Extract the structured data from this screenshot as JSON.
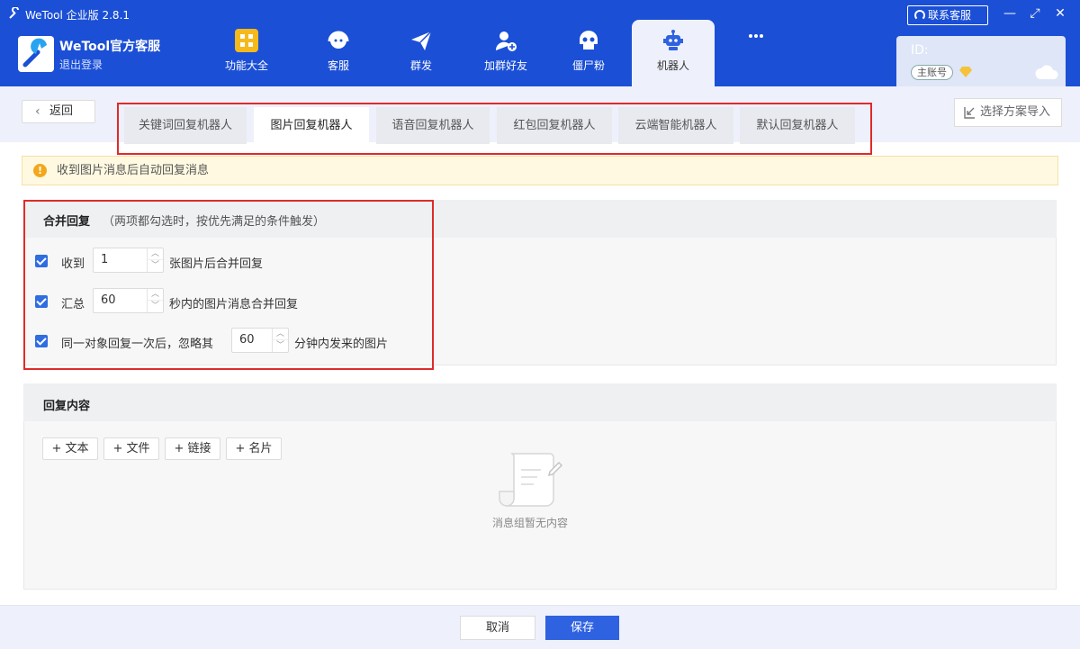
{
  "window": {
    "title": "WeTool 企业版 2.8.1",
    "contact_label": "联系客服",
    "min_glyph": "—",
    "max_glyph": "⤢",
    "close_glyph": "✕"
  },
  "brand": {
    "name": "WeTool官方客服",
    "logout_label": "退出登录"
  },
  "nav": {
    "items": [
      {
        "label": "功能大全",
        "icon": "grid-icon"
      },
      {
        "label": "客服",
        "icon": "headset-icon"
      },
      {
        "label": "群发",
        "icon": "send-icon"
      },
      {
        "label": "加群好友",
        "icon": "add-friend-icon"
      },
      {
        "label": "僵尸粉",
        "icon": "skull-icon"
      },
      {
        "label": "机器人",
        "icon": "robot-icon",
        "active": true
      },
      {
        "label": "",
        "icon": "more-icon"
      }
    ]
  },
  "account": {
    "id_label": "ID:",
    "badge": "主账号"
  },
  "toolbar": {
    "back_label": "返回",
    "import_label": "选择方案导入",
    "tabs": [
      {
        "label": "关键词回复机器人",
        "active": false
      },
      {
        "label": "图片回复机器人",
        "active": true
      },
      {
        "label": "语音回复机器人",
        "active": false
      },
      {
        "label": "红包回复机器人",
        "active": false
      },
      {
        "label": "云端智能机器人",
        "active": false
      },
      {
        "label": "默认回复机器人",
        "active": false
      }
    ]
  },
  "notice": {
    "icon": "!",
    "text": "收到图片消息后自动回复消息"
  },
  "merge": {
    "title": "合并回复",
    "note": "（两项都勾选时，按优先满足的条件触发）",
    "options": [
      {
        "checked": true,
        "prefix": "收到",
        "value": "1",
        "suffix": "张图片后合并回复"
      },
      {
        "checked": true,
        "prefix": "汇总",
        "value": "60",
        "suffix": "秒内的图片消息合并回复"
      },
      {
        "checked": true,
        "prefix": "同一对象回复一次后，忽略其",
        "value": "60",
        "suffix": "分钟内发来的图片"
      }
    ]
  },
  "reply": {
    "title": "回复内容",
    "buttons": [
      "+ 文本",
      "+ 文件",
      "+ 链接",
      "+ 名片"
    ],
    "empty_text": "消息组暂无内容"
  },
  "footer": {
    "cancel_label": "取消",
    "save_label": "保存"
  },
  "colors": {
    "brand_blue": "#1b4fd6",
    "accent_blue": "#2f62e0",
    "highlight_red": "#e02a2a",
    "warning_orange": "#f2a81c"
  }
}
